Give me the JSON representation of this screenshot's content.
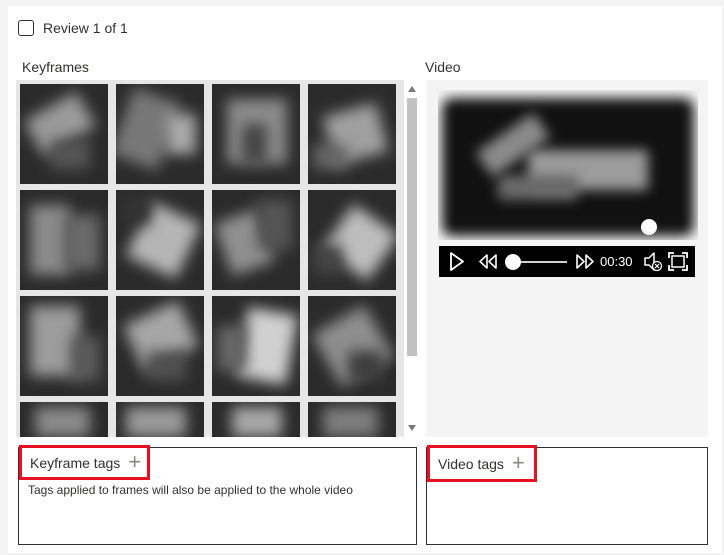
{
  "review": {
    "label": "Review 1 of 1",
    "checked": false
  },
  "keyframes": {
    "label": "Keyframes"
  },
  "video": {
    "label": "Video",
    "time": "00:30",
    "progress": 0.0
  },
  "keyframe_tags": {
    "title": "Keyframe tags",
    "hint": "Tags applied to frames will also be applied to the whole video"
  },
  "video_tags": {
    "title": "Video tags"
  },
  "icons": {
    "checkbox": "checkbox-icon",
    "add": "plus-icon",
    "play": "play-icon",
    "rewind": "rewind-icon",
    "fast_forward": "fast-forward-icon",
    "mute": "speaker-mute-icon",
    "fullscreen": "fullscreen-icon"
  },
  "colors": {
    "highlight": "#e81123",
    "player_bar": "#000000"
  }
}
